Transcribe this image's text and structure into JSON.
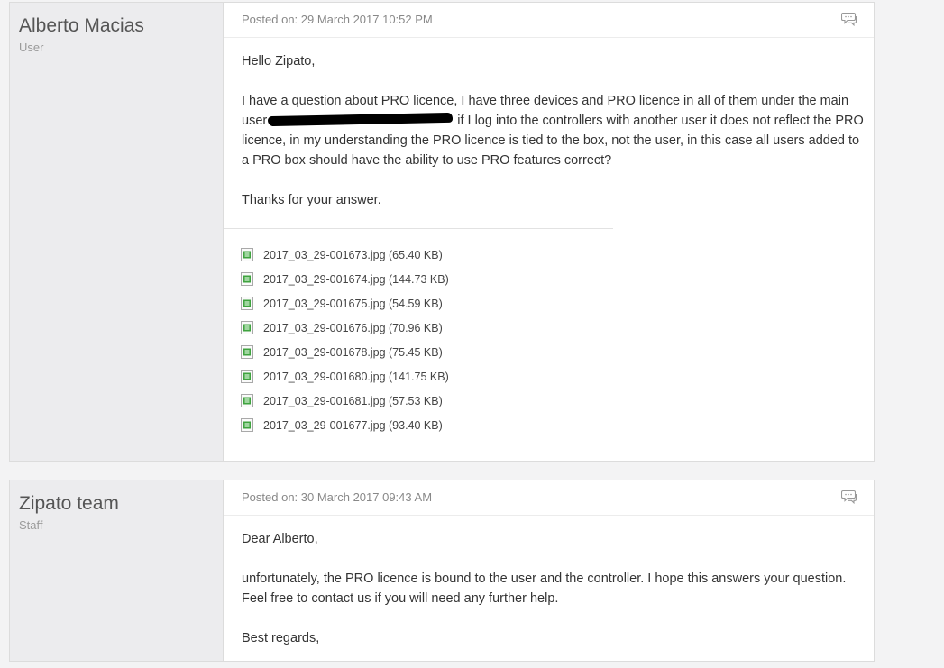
{
  "posts": [
    {
      "author": "Alberto Macias",
      "role": "User",
      "posted_on": "Posted on: 29 March 2017 10:52 PM",
      "greeting": "Hello Zipato,",
      "body_part1": "I have a question about PRO licence, I have three devices and PRO licence in all of them under the main user",
      "body_part2": " if I log into the controllers with another user it does not reflect the PRO licence, in my understanding the PRO licence is tied to the box, not the user, in this case all users added to a PRO box should have the ability to use PRO features correct?",
      "closing": "Thanks for your answer.",
      "attachments": [
        "2017_03_29-001673.jpg (65.40 KB)",
        "2017_03_29-001674.jpg (144.73 KB)",
        "2017_03_29-001675.jpg (54.59 KB)",
        "2017_03_29-001676.jpg (70.96 KB)",
        "2017_03_29-001678.jpg (75.45 KB)",
        "2017_03_29-001680.jpg (141.75 KB)",
        "2017_03_29-001681.jpg (57.53 KB)",
        "2017_03_29-001677.jpg (93.40 KB)"
      ]
    },
    {
      "author": "Zipato team",
      "role": "Staff",
      "posted_on": "Posted on: 30 March 2017 09:43 AM",
      "greeting": "Dear Alberto,",
      "body": "unfortunately, the PRO licence is bound to the user and the controller. I hope this answers your question. Feel free to contact us if you will need any further help.",
      "closing": "Best regards,"
    }
  ],
  "icons": {
    "quote": "speech-bubble-icon",
    "attachment": "image-file-icon"
  },
  "colors": {
    "page_bg": "#f3f3f4",
    "author_panel_bg": "#ececee",
    "file_icon_green": "#3fa33f"
  }
}
